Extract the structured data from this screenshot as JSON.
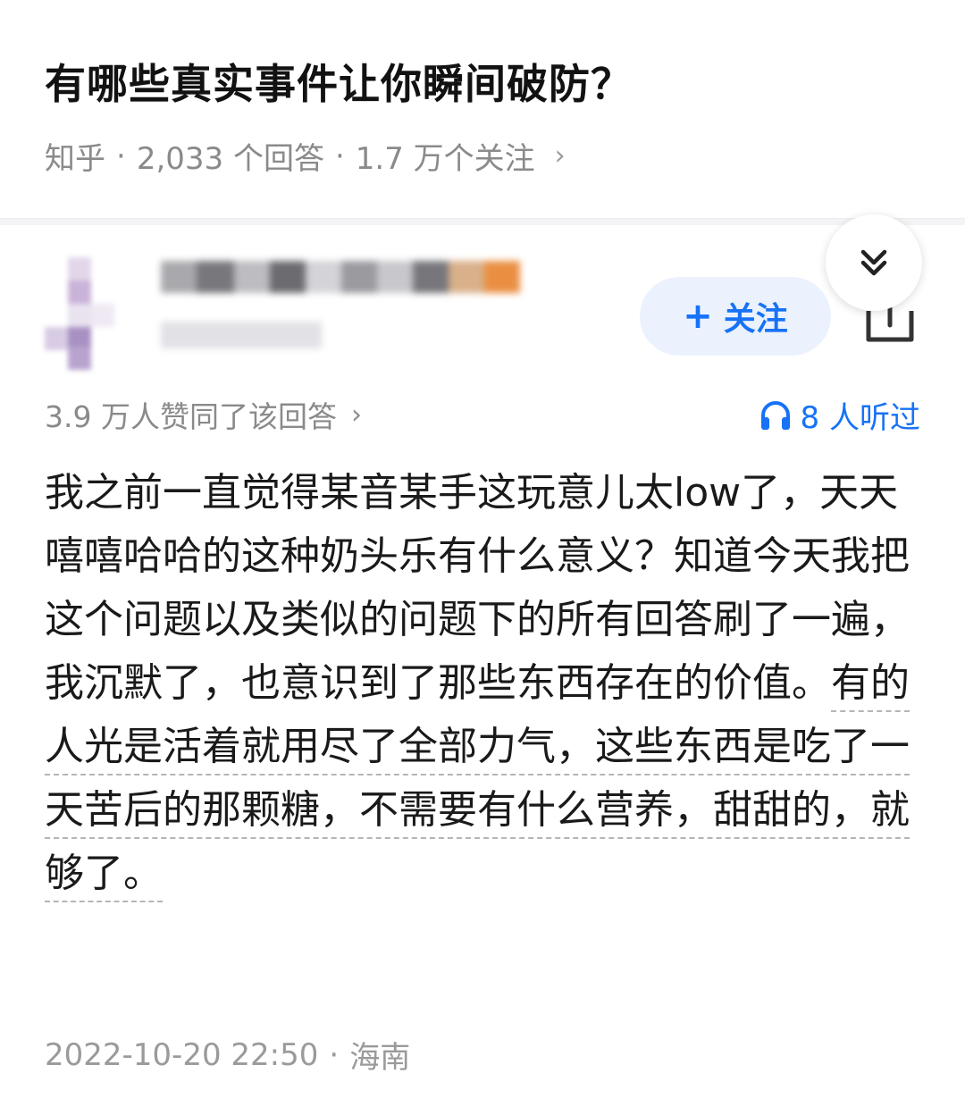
{
  "question": {
    "title": "有哪些真实事件让你瞬间破防？",
    "source": "知乎",
    "answer_count": "2,033 个回答",
    "follower_count": "1.7 万个关注",
    "meta_separator": "·",
    "chevron": "›"
  },
  "author": {
    "avatar_icon": "blurred-avatar",
    "follow_plus": "+",
    "follow_label": "关注",
    "share_icon": "share-icon",
    "collapse_icon": "double-chevron-down-icon"
  },
  "stats": {
    "likes_text": "3.9 万人赞同了该回答",
    "likes_chevron": "›",
    "listened_text": "8 人听过",
    "listened_icon": "headphones-icon"
  },
  "answer": {
    "text_plain": "我之前一直觉得某音某手这玩意儿太low了，天天嘻嘻哈哈的这种奶头乐有什么意义？知道今天我把这个问题以及类似的问题下的所有回答刷了一遍，我沉默了，也意识到了那些东西存在的价值。",
    "text_highlight": "有的人光是活着就用尽了全部力气，这些东西是吃了一天苦后的那颗糖，不需要有什么营养，甜甜的，就够了。"
  },
  "footer": {
    "datetime": "2022-10-20 22:50",
    "separator": "·",
    "location": "海南"
  },
  "colors": {
    "accent": "#1772f6",
    "follow_bg": "#ebf2fd",
    "meta_gray": "#8a8a8a",
    "text": "#1a1a1a"
  }
}
